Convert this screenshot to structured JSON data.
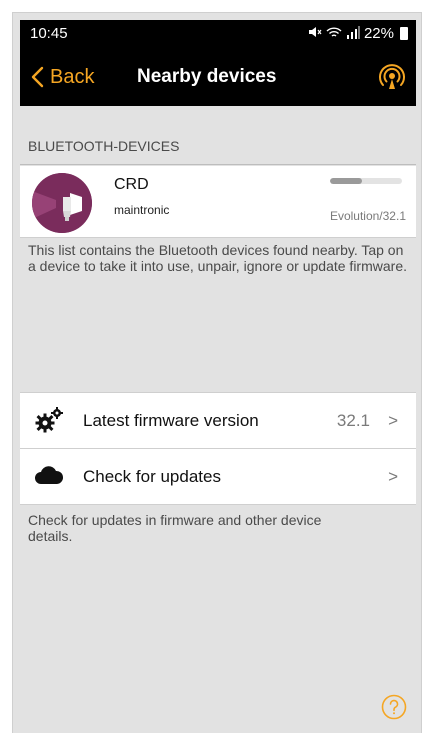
{
  "status_bar": {
    "time": "10:45",
    "battery": "22%",
    "icons": [
      "mute-icon",
      "wifi-icon",
      "signal-icon",
      "battery-icon"
    ]
  },
  "nav": {
    "back_label": "Back",
    "title": "Nearby devices",
    "accent": "#f5a623"
  },
  "section": {
    "header": "BLUETOOTH-DEVICES"
  },
  "device": {
    "name": "CRD",
    "maker": "maintronic",
    "version": "Evolution/32.1",
    "signal_level": 0.45,
    "avatar_color": "#7a2c5c"
  },
  "description_1": "This list contains the Bluetooth devices found nearby. Tap on a device to take it into use, unpair, ignore or update firmware.",
  "rows": {
    "firmware": {
      "label": "Latest firmware version",
      "value": "32.1",
      "chevron": ">"
    },
    "updates": {
      "label": "Check for updates",
      "chevron": ">"
    }
  },
  "description_2": "Check for updates in firmware and other device details."
}
